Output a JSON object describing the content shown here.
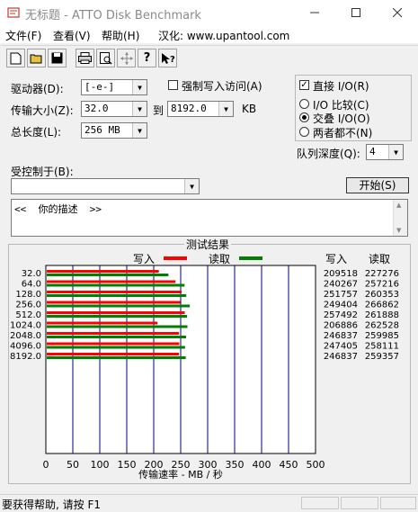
{
  "window": {
    "title": "无标题 - ATTO Disk Benchmark"
  },
  "menu": {
    "file": "文件(F)",
    "view": "查看(V)",
    "help": "帮助(H)",
    "localize": "汉化: www.upantool.com"
  },
  "drive": {
    "label": "驱动器(D):",
    "value": "[-e-]"
  },
  "force_write": {
    "label": "强制写入访问(A)",
    "checked": false
  },
  "transfer_size": {
    "label": "传输大小(Z):",
    "from": "32.0",
    "to_label": "到",
    "to": "8192.0",
    "unit": "KB"
  },
  "total_length": {
    "label": "总长度(L):",
    "value": "256 MB"
  },
  "direct_io": {
    "label": "直接 I/O(R)",
    "checked": true
  },
  "io_mode": {
    "compare": "I/O 比较(C)",
    "overlap": "交叠 I/O(O)",
    "neither": "两者都不(N)",
    "selected": "overlap"
  },
  "queue_depth": {
    "label": "队列深度(Q):",
    "value": "4"
  },
  "controlled_by": {
    "label": "受控制于(B):",
    "value": ""
  },
  "start_button": "开始(S)",
  "description": {
    "text": "<<  你的描述  >>"
  },
  "results": {
    "title": "测试结果",
    "write_label": "写入",
    "read_label": "读取",
    "col_write": "写入",
    "col_read": "读取"
  },
  "colors": {
    "write": "#ff0000",
    "read": "#008000",
    "grid": "#000080"
  },
  "chart_data": {
    "type": "bar",
    "orientation": "horizontal",
    "categories": [
      "32.0",
      "64.0",
      "128.0",
      "256.0",
      "512.0",
      "1024.0",
      "2048.0",
      "4096.0",
      "8192.0"
    ],
    "series": [
      {
        "name": "写入",
        "values": [
          209518,
          240267,
          251757,
          249404,
          257492,
          206886,
          246837,
          247405,
          246837
        ]
      },
      {
        "name": "读取",
        "values": [
          227276,
          257216,
          260353,
          266862,
          261888,
          262528,
          259985,
          258111,
          259357
        ]
      }
    ],
    "x_ticks": [
      "0",
      "50",
      "100",
      "150",
      "200",
      "250",
      "300",
      "350",
      "400",
      "450",
      "500"
    ],
    "xlim": [
      0,
      500
    ],
    "xlabel": "传输速率 - MB / 秒",
    "grid": true
  },
  "status": {
    "text": "要获得帮助, 请按 F1"
  }
}
